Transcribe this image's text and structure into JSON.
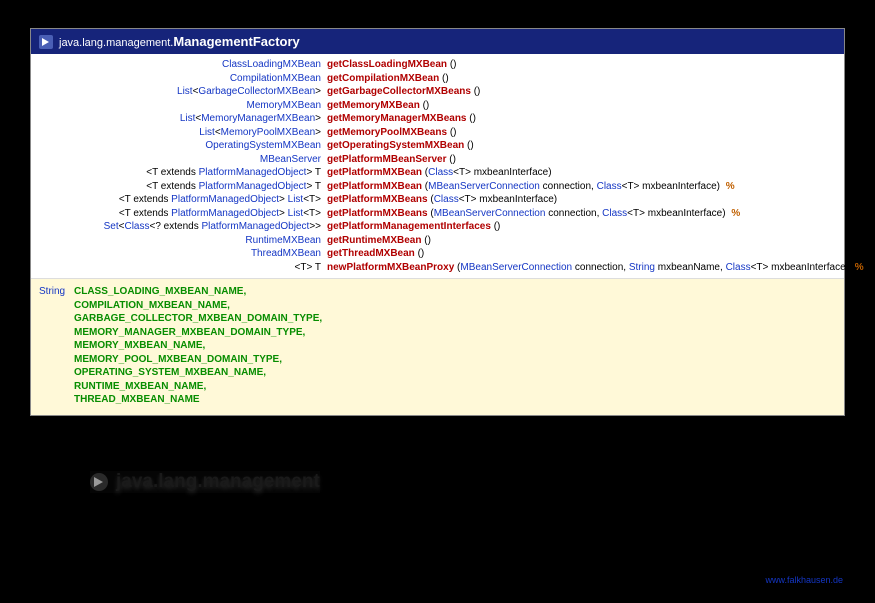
{
  "header": {
    "package": "java.lang.management.",
    "class": "ManagementFactory"
  },
  "methods": [
    {
      "ret": [
        {
          "t": "link",
          "v": "ClassLoadingMXBean"
        }
      ],
      "name": "getClassLoadingMXBean",
      "params": "()"
    },
    {
      "ret": [
        {
          "t": "link",
          "v": "CompilationMXBean"
        }
      ],
      "name": "getCompilationMXBean",
      "params": "()"
    },
    {
      "ret": [
        {
          "t": "link",
          "v": "List"
        },
        {
          "t": "plain",
          "v": "<"
        },
        {
          "t": "link",
          "v": "GarbageCollectorMXBean"
        },
        {
          "t": "plain",
          "v": ">"
        }
      ],
      "name": "getGarbageCollectorMXBeans",
      "params": "()"
    },
    {
      "ret": [
        {
          "t": "link",
          "v": "MemoryMXBean"
        }
      ],
      "name": "getMemoryMXBean",
      "params": "()"
    },
    {
      "ret": [
        {
          "t": "link",
          "v": "List"
        },
        {
          "t": "plain",
          "v": "<"
        },
        {
          "t": "link",
          "v": "MemoryManagerMXBean"
        },
        {
          "t": "plain",
          "v": ">"
        }
      ],
      "name": "getMemoryManagerMXBeans",
      "params": "()"
    },
    {
      "ret": [
        {
          "t": "link",
          "v": "List"
        },
        {
          "t": "plain",
          "v": "<"
        },
        {
          "t": "link",
          "v": "MemoryPoolMXBean"
        },
        {
          "t": "plain",
          "v": ">"
        }
      ],
      "name": "getMemoryPoolMXBeans",
      "params": "()"
    },
    {
      "ret": [
        {
          "t": "link",
          "v": "OperatingSystemMXBean"
        }
      ],
      "name": "getOperatingSystemMXBean",
      "params": "()"
    },
    {
      "ret": [
        {
          "t": "link",
          "v": "MBeanServer"
        }
      ],
      "name": "getPlatformMBeanServer",
      "params": "()"
    },
    {
      "ret": [
        {
          "t": "plain",
          "v": "<T extends "
        },
        {
          "t": "link",
          "v": "PlatformManagedObject"
        },
        {
          "t": "plain",
          "v": "> T"
        }
      ],
      "name": "getPlatformMXBean",
      "params": [
        {
          "t": "plain",
          "v": " ("
        },
        {
          "t": "link",
          "v": "Class"
        },
        {
          "t": "plain",
          "v": "<T> mxbeanInterface)"
        }
      ]
    },
    {
      "ret": [
        {
          "t": "plain",
          "v": "<T extends "
        },
        {
          "t": "link",
          "v": "PlatformManagedObject"
        },
        {
          "t": "plain",
          "v": "> T"
        }
      ],
      "name": "getPlatformMXBean",
      "params": [
        {
          "t": "plain",
          "v": " ("
        },
        {
          "t": "link",
          "v": "MBeanServerConnection"
        },
        {
          "t": "plain",
          "v": " connection, "
        },
        {
          "t": "link",
          "v": "Class"
        },
        {
          "t": "plain",
          "v": "<T> mxbeanInterface) "
        }
      ],
      "mark": "%"
    },
    {
      "ret": [
        {
          "t": "plain",
          "v": "<T extends "
        },
        {
          "t": "link",
          "v": "PlatformManagedObject"
        },
        {
          "t": "plain",
          "v": "> "
        },
        {
          "t": "link",
          "v": "List"
        },
        {
          "t": "plain",
          "v": "<T>"
        }
      ],
      "name": "getPlatformMXBeans",
      "params": [
        {
          "t": "plain",
          "v": " ("
        },
        {
          "t": "link",
          "v": "Class"
        },
        {
          "t": "plain",
          "v": "<T> mxbeanInterface)"
        }
      ]
    },
    {
      "ret": [
        {
          "t": "plain",
          "v": "<T extends "
        },
        {
          "t": "link",
          "v": "PlatformManagedObject"
        },
        {
          "t": "plain",
          "v": "> "
        },
        {
          "t": "link",
          "v": "List"
        },
        {
          "t": "plain",
          "v": "<T>"
        }
      ],
      "name": "getPlatformMXBeans",
      "params": [
        {
          "t": "plain",
          "v": " ("
        },
        {
          "t": "link",
          "v": "MBeanServerConnection"
        },
        {
          "t": "plain",
          "v": " connection, "
        },
        {
          "t": "link",
          "v": "Class"
        },
        {
          "t": "plain",
          "v": "<T> mxbeanInterface) "
        }
      ],
      "mark": "%"
    },
    {
      "ret": [
        {
          "t": "link",
          "v": "Set"
        },
        {
          "t": "plain",
          "v": "<"
        },
        {
          "t": "link",
          "v": "Class"
        },
        {
          "t": "plain",
          "v": "<? extends "
        },
        {
          "t": "link",
          "v": "PlatformManagedObject"
        },
        {
          "t": "plain",
          "v": ">>"
        }
      ],
      "name": "getPlatformManagementInterfaces",
      "params": "()"
    },
    {
      "ret": [
        {
          "t": "link",
          "v": "RuntimeMXBean"
        }
      ],
      "name": "getRuntimeMXBean",
      "params": "()"
    },
    {
      "ret": [
        {
          "t": "link",
          "v": "ThreadMXBean"
        }
      ],
      "name": "getThreadMXBean",
      "params": "()"
    },
    {
      "ret": [
        {
          "t": "plain",
          "v": "<T> T"
        }
      ],
      "name": "newPlatformMXBeanProxy",
      "params": [
        {
          "t": "plain",
          "v": " ("
        },
        {
          "t": "link",
          "v": "MBeanServerConnection"
        },
        {
          "t": "plain",
          "v": " connection, "
        },
        {
          "t": "link",
          "v": "String"
        },
        {
          "t": "plain",
          "v": " mxbeanName, "
        },
        {
          "t": "link",
          "v": "Class"
        },
        {
          "t": "plain",
          "v": "<T> mxbeanInterface) "
        }
      ],
      "mark": "%"
    }
  ],
  "constants": {
    "type": "String",
    "names": [
      "CLASS_LOADING_MXBEAN_NAME",
      "COMPILATION_MXBEAN_NAME",
      "GARBAGE_COLLECTOR_MXBEAN_DOMAIN_TYPE",
      "MEMORY_MANAGER_MXBEAN_DOMAIN_TYPE",
      "MEMORY_MXBEAN_NAME",
      "MEMORY_POOL_MXBEAN_DOMAIN_TYPE",
      "OPERATING_SYSTEM_MXBEAN_NAME",
      "RUNTIME_MXBEAN_NAME",
      "THREAD_MXBEAN_NAME"
    ]
  },
  "footer": {
    "label": "java.lang.management",
    "credit": "www.falkhausen.de"
  }
}
